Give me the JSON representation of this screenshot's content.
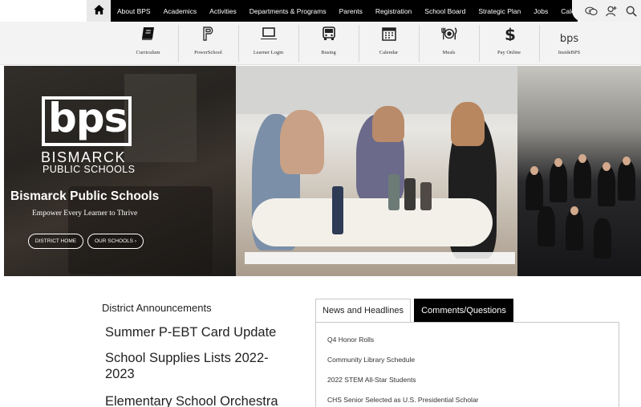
{
  "topnav": {
    "links": [
      "About BPS",
      "Academics",
      "Activities",
      "Departments & Programs",
      "Parents",
      "Registration",
      "School Board",
      "Strategic Plan",
      "Jobs",
      "Calendar"
    ],
    "icons": [
      "home-icon",
      "translate-icon",
      "user-add-icon",
      "search-icon"
    ]
  },
  "quicklinks": [
    {
      "label": "Curriculum",
      "icon": "book-icon"
    },
    {
      "label": "PowerSchool",
      "icon": "powerschool-icon"
    },
    {
      "label": "Learner Login",
      "icon": "laptop-icon"
    },
    {
      "label": "Busing",
      "icon": "bus-icon"
    },
    {
      "label": "Calendar",
      "icon": "calendar-icon"
    },
    {
      "label": "Meals",
      "icon": "meals-icon"
    },
    {
      "label": "Pay Online",
      "icon": "dollar-icon"
    },
    {
      "label": "InsideBPS",
      "icon": "insidebps-icon"
    }
  ],
  "insidebps_logo": "bps",
  "hero": {
    "logo_text": "bps",
    "logo_name": "BISMARCK",
    "logo_sub": "PUBLIC SCHOOLS",
    "title": "Bismarck Public Schools",
    "tagline": "Empower Every Learner to Thrive",
    "buttons": [
      "DISTRICT HOME",
      "OUR SCHOOLS ›"
    ]
  },
  "announcements": {
    "heading": "District Announcements",
    "items": [
      "Summer P-EBT Card Update",
      "School Supplies Lists 2022-2023",
      "Elementary School Orchestra"
    ]
  },
  "tabs": {
    "news": "News and Headlines",
    "comments": "Comments/Questions",
    "headlines": [
      "Q4 Honor Rolls",
      "Community Library Schedule",
      "2022 STEM All-Star Students",
      "CHS Senior Selected as U.S. Presidential Scholar"
    ]
  },
  "colors": {
    "nav_bg": "#000000",
    "quickbar_bg": "#f3f3f3",
    "active_tab": "#000000"
  }
}
